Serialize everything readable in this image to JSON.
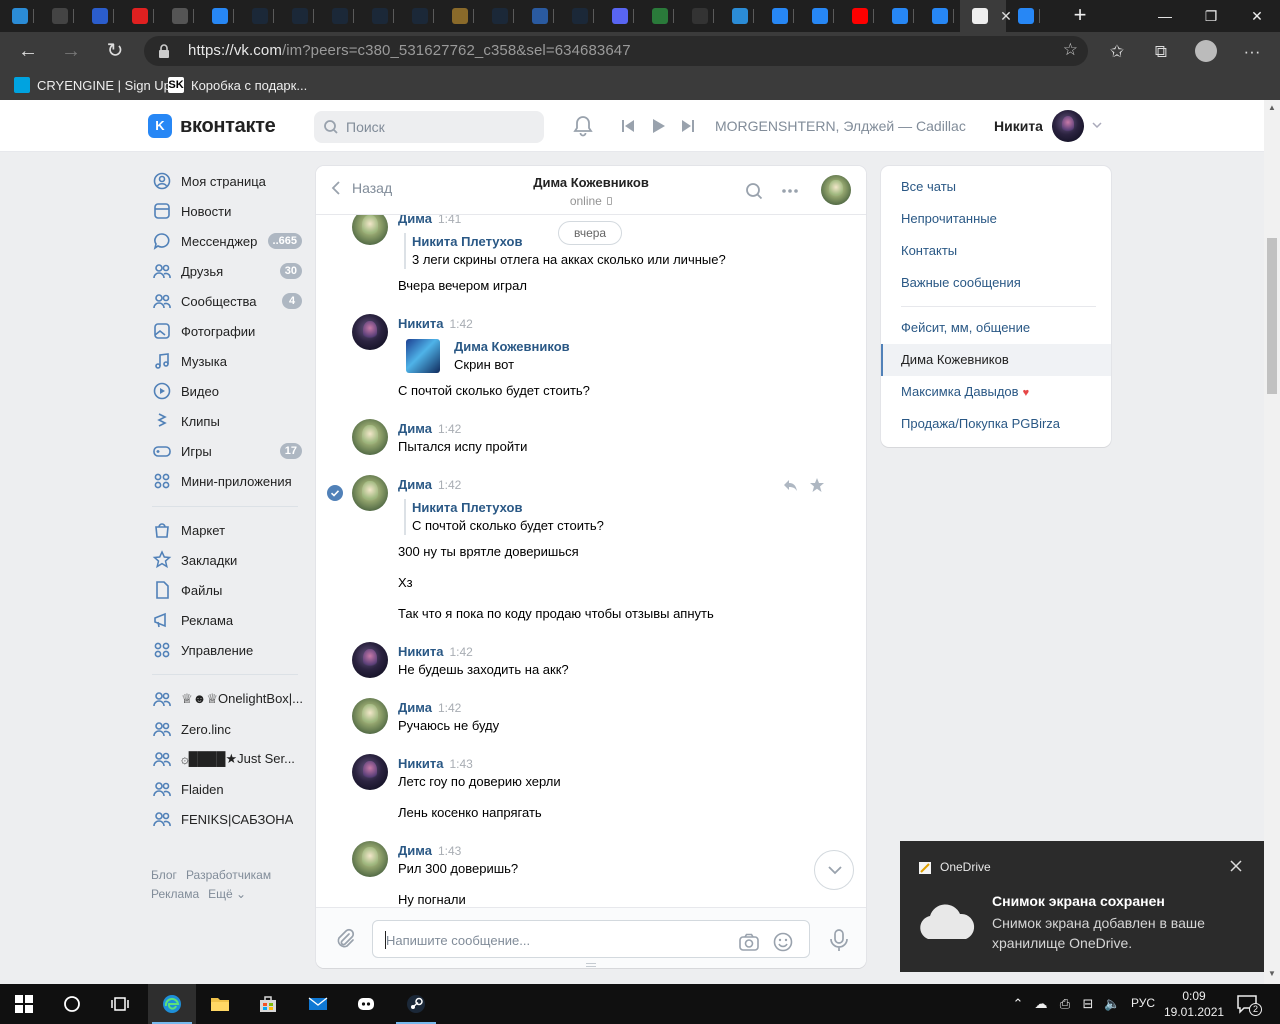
{
  "browser": {
    "url_host": "https://vk.com",
    "url_rest": "/im?peers=c380_531627762_c358&sel=634683647",
    "bookmarks": [
      {
        "label": "CRYENGINE | Sign Up",
        "color": "#00a3e0"
      },
      {
        "label": "Коробка с подарк...",
        "color": "#222222"
      }
    ],
    "tab_colors": [
      "#2b8cd6",
      "#444444",
      "#2b5dcc",
      "#e02020",
      "#555555",
      "#2787f5",
      "#1b2838",
      "#1b2838",
      "#1b2838",
      "#1b2838",
      "#1b2838",
      "#8a6a2a",
      "#1b2838",
      "#2a5aa0",
      "#1b2838",
      "#5865f2",
      "#2a7a3a",
      "#333333",
      "#2b8cd6",
      "#2787f5",
      "#2787f5",
      "#ff0000",
      "#2787f5",
      "#2787f5",
      "#eeeeee",
      "#2787f5"
    ],
    "newtab_glyph": "+"
  },
  "vk": {
    "logo_letter": "K",
    "logo_text": "вконтакте",
    "search_placeholder": "Поиск",
    "now_playing": "MORGENSHTERN, Элджей — Cadillac",
    "user_name": "Никита"
  },
  "menu": {
    "main": [
      {
        "label": "Моя страница",
        "icon": "user-circle-icon",
        "badge": ""
      },
      {
        "label": "Новости",
        "icon": "news-icon",
        "badge": ""
      },
      {
        "label": "Мессенджер",
        "icon": "message-icon",
        "badge": "..665"
      },
      {
        "label": "Друзья",
        "icon": "friends-icon",
        "badge": "30"
      },
      {
        "label": "Сообщества",
        "icon": "groups-icon",
        "badge": "4"
      },
      {
        "label": "Фотографии",
        "icon": "photo-icon",
        "badge": ""
      },
      {
        "label": "Музыка",
        "icon": "music-icon",
        "badge": ""
      },
      {
        "label": "Видео",
        "icon": "video-icon",
        "badge": ""
      },
      {
        "label": "Клипы",
        "icon": "clips-icon",
        "badge": ""
      },
      {
        "label": "Игры",
        "icon": "games-icon",
        "badge": "17"
      },
      {
        "label": "Мини-приложения",
        "icon": "apps-icon",
        "badge": ""
      }
    ],
    "secondary": [
      {
        "label": "Маркет",
        "icon": "market-icon"
      },
      {
        "label": "Закладки",
        "icon": "bookmark-star-icon"
      },
      {
        "label": "Файлы",
        "icon": "file-icon"
      },
      {
        "label": "Реклама",
        "icon": "ads-icon"
      },
      {
        "label": "Управление",
        "icon": "manage-icon"
      }
    ],
    "groups": [
      {
        "label": "♕☻♕OnelightBox|..."
      },
      {
        "label": "Zero.linc"
      },
      {
        "label": "۞████★Just Ser..."
      },
      {
        "label": "Flaiden"
      },
      {
        "label": "FENIKS|САБЗОНА"
      }
    ],
    "footer": [
      "Блог",
      "Разработчикам",
      "Реклама",
      "Ещё ⌄"
    ]
  },
  "chat": {
    "back_label": "Назад",
    "title": "Дима Кожевников",
    "status": "online",
    "date_pill": "вчера",
    "input_placeholder": "Напишите сообщение...",
    "messages": [
      {
        "author": "Дима",
        "time": "1:41",
        "fwd_author": "Никита Плетухов",
        "fwd_text": "3 леги скрины отлега на акках сколько или личные?",
        "text": "Вчера вечером играл"
      },
      {
        "author": "Никита",
        "time": "1:42",
        "fwd_author": "Дима Кожевников",
        "fwd_text": "Скрин вот",
        "text": "С почтой сколько будет стоить?"
      },
      {
        "author": "Дима",
        "time": "1:42",
        "text": "Пытался испу пройти"
      },
      {
        "author": "Дима",
        "time": "1:42",
        "fwd_author": "Никита Плетухов",
        "fwd_text": "С почтой сколько будет стоить?",
        "texts": [
          "300 ну ты врятле доверишься",
          "Хз",
          "Так что я пока по коду продаю чтобы отзывы апнуть"
        ]
      },
      {
        "author": "Никита",
        "time": "1:42",
        "text": "Не будешь заходить на акк?"
      },
      {
        "author": "Дима",
        "time": "1:42",
        "text": "Ручаюсь не буду"
      },
      {
        "author": "Никита",
        "time": "1:43",
        "texts": [
          "Летс гоу по доверию херли",
          "Лень косенко напрягать"
        ]
      },
      {
        "author": "Дима",
        "time": "1:43",
        "texts": [
          "Рил 300 доверишь?",
          "Ну погнали"
        ]
      }
    ]
  },
  "right_panel": {
    "filters": [
      "Все чаты",
      "Непрочитанные",
      "Контакты",
      "Важные сообщения"
    ],
    "chats": [
      "Фейсит, мм, общение",
      "Дима Кожевников",
      "Максимка Давыдов",
      "Продажа/Покупка PGBirza"
    ],
    "active_chat": "Дима Кожевников",
    "heart_glyph": "♥"
  },
  "toast": {
    "app": "OneDrive",
    "title": "Снимок экрана сохранен",
    "body": "Снимок экрана добавлен в ваше хранилище OneDrive."
  },
  "taskbar": {
    "lang": "РУС",
    "time": "0:09",
    "date": "19.01.2021",
    "notifications": "2"
  },
  "colors": {
    "vk_blue": "#2787f5",
    "link": "#2a5885",
    "page_bg": "#edeef0",
    "heart": "#e64646"
  }
}
